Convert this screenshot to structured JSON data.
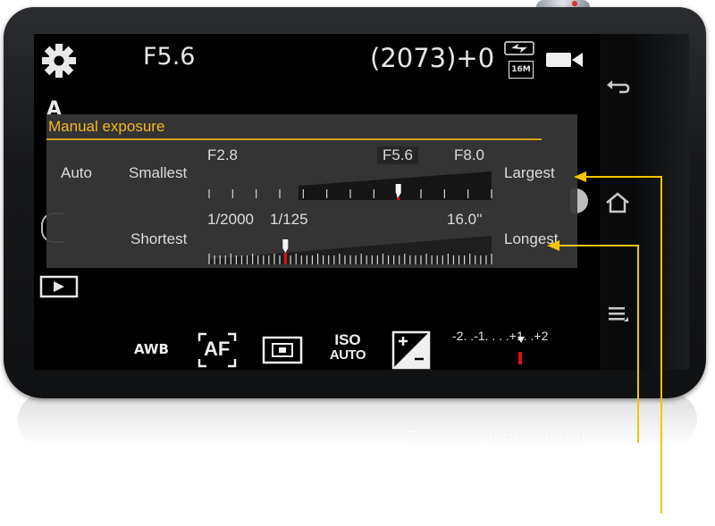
{
  "topbar": {
    "settings_icon": "gear-icon",
    "aperture_value": "F5.6",
    "shots_remaining": "(2073)+0",
    "flash_icon": "flash-icon",
    "resolution_badge": "16M",
    "video_icon": "video-camera-icon"
  },
  "left_column": {
    "mode_letter": "A",
    "playback_icon": "playback-icon"
  },
  "panel": {
    "title": "Manual exposure",
    "aperture": {
      "mode_label": "Auto",
      "min_label": "Smallest",
      "max_label": "Largest",
      "scale_start": "F2.8",
      "scale_current": "F5.6",
      "scale_end": "F8.0",
      "position": 0.67
    },
    "shutter": {
      "min_label": "Shortest",
      "max_label": "Longest",
      "scale_start": "1/2000",
      "scale_current": "1/125",
      "scale_end": "16.0''",
      "position": 0.27
    }
  },
  "bottom_bar": {
    "awb_label": "AWB",
    "af_label": "AF",
    "metering_icon": "metering-icon",
    "iso_label": "ISO",
    "iso_value": "AUTO",
    "ev_icon": "exposure-compensation-icon",
    "ev_scale": "-2. .-1. . . .+1. .+2"
  },
  "nav": {
    "back_icon": "back-icon",
    "home_icon": "home-icon",
    "menu_icon": "menu-icon"
  },
  "annotation": {
    "caption": "Exposure time control",
    "color": "#f5c400"
  },
  "colors": {
    "accent": "#f2b81c",
    "marker_red": "#e01010"
  }
}
